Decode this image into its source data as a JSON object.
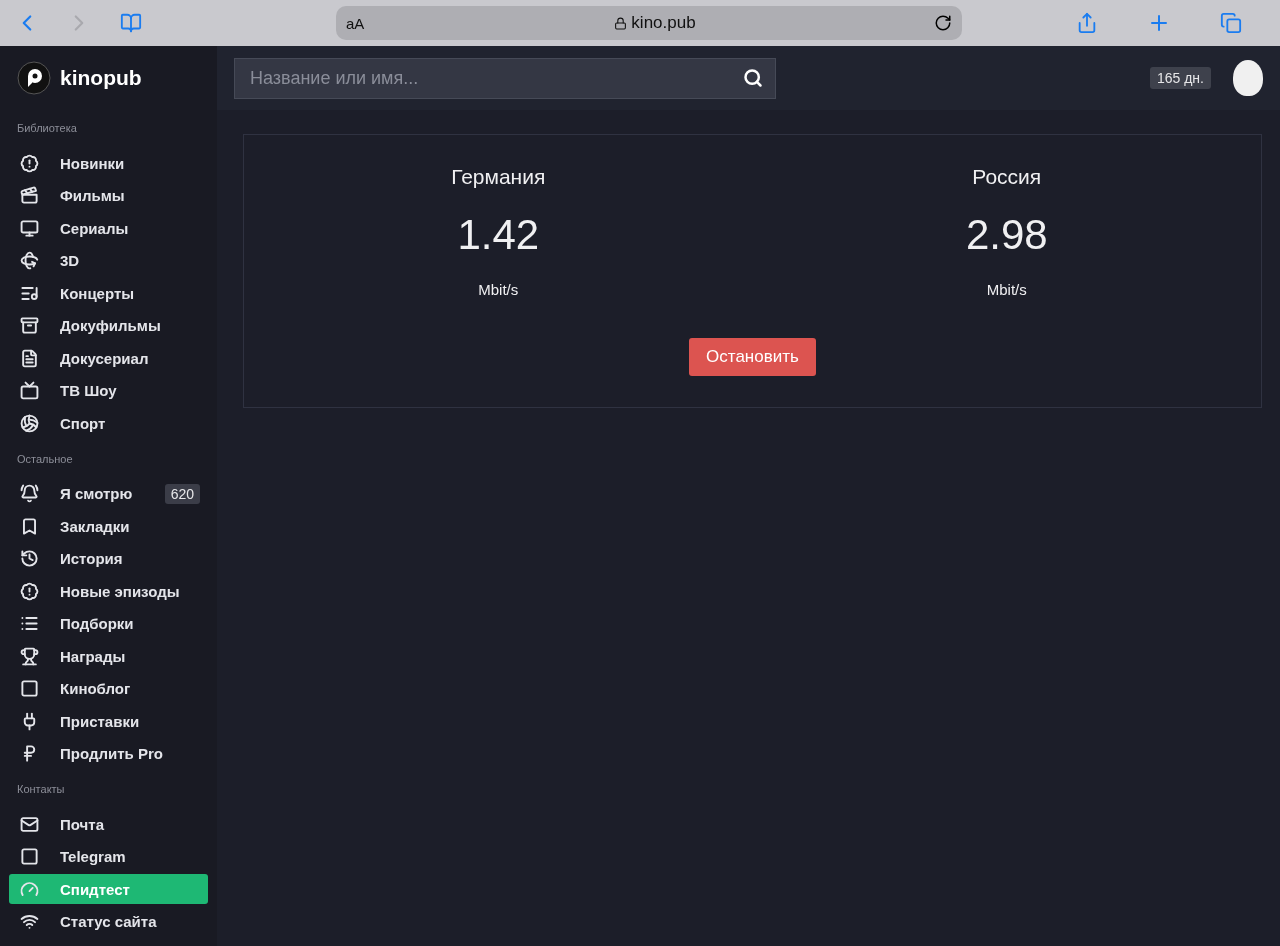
{
  "browser": {
    "text_size": "aA",
    "url": "kino.pub"
  },
  "logo": {
    "text": "kinopub"
  },
  "search": {
    "placeholder": "Название или имя..."
  },
  "header": {
    "days_badge": "165 дн."
  },
  "sidebar": {
    "sections": [
      {
        "title": "Библиотека",
        "items": [
          {
            "label": "Новинки",
            "selected": false
          },
          {
            "label": "Фильмы",
            "selected": false
          },
          {
            "label": "Сериалы",
            "selected": false
          },
          {
            "label": "3D",
            "selected": false
          },
          {
            "label": "Концерты",
            "selected": false
          },
          {
            "label": "Докуфильмы",
            "selected": false
          },
          {
            "label": "Докусериал",
            "selected": false
          },
          {
            "label": "ТВ Шоу",
            "selected": false
          },
          {
            "label": "Спорт",
            "selected": false
          }
        ]
      },
      {
        "title": "Остальное",
        "items": [
          {
            "label": "Я смотрю",
            "selected": false,
            "badge": "620"
          },
          {
            "label": "Закладки",
            "selected": false
          },
          {
            "label": "История",
            "selected": false
          },
          {
            "label": "Новые эпизоды",
            "selected": false
          },
          {
            "label": "Подборки",
            "selected": false
          },
          {
            "label": "Награды",
            "selected": false
          },
          {
            "label": "Киноблог",
            "selected": false
          },
          {
            "label": "Приставки",
            "selected": false
          },
          {
            "label": "Продлить Pro",
            "selected": false
          }
        ]
      },
      {
        "title": "Контакты",
        "items": [
          {
            "label": "Почта",
            "selected": false
          },
          {
            "label": "Telegram",
            "selected": false
          },
          {
            "label": "Спидтест",
            "selected": true
          },
          {
            "label": "Статус сайта",
            "selected": false
          }
        ]
      }
    ]
  },
  "speedtest": {
    "results": [
      {
        "location": "Германия",
        "value": "1.42",
        "unit": "Mbit/s"
      },
      {
        "location": "Россия",
        "value": "2.98",
        "unit": "Mbit/s"
      }
    ],
    "button": "Остановить"
  }
}
